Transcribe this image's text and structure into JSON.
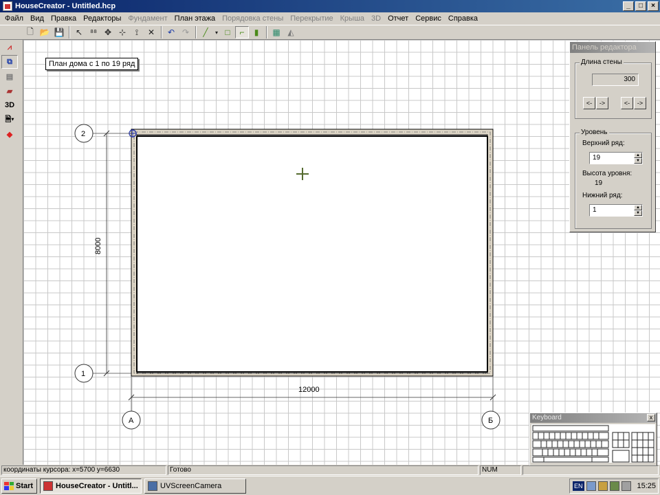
{
  "window": {
    "title": "HouseCreator - Untitled.hcp"
  },
  "menu": [
    "Файл",
    "Вид",
    "Правка",
    "Редакторы",
    "Фундамент",
    "План этажа",
    "Порядовка стены",
    "Перекрытие",
    "Крыша",
    "3D",
    "Отчет",
    "Сервис",
    "Справка"
  ],
  "menu_disabled": [
    false,
    false,
    false,
    false,
    true,
    false,
    true,
    true,
    true,
    true,
    false,
    false,
    false
  ],
  "left_toolbar": {
    "view3d_label": "3D"
  },
  "plan_label": "План дома с 1 по 19 ряд",
  "drawing": {
    "axis_rows": [
      "2",
      "1"
    ],
    "axis_cols": [
      "А",
      "Б"
    ],
    "dim_width": "12000",
    "dim_height": "8000"
  },
  "editor_panel": {
    "title": "Панель редактора",
    "wall_length_label": "Длина стены",
    "wall_length_value": "300",
    "btn_left": "<-",
    "btn_right": "->",
    "level_label": "Уровень",
    "top_row_label": "Верхний ряд:",
    "top_row_value": "19",
    "level_height_label": "Высота уровня:",
    "level_height_value": "19",
    "bottom_row_label": "Нижний ряд:",
    "bottom_row_value": "1"
  },
  "keyboard_window": {
    "title": "Keyboard",
    "close": "x"
  },
  "status": {
    "coords": "координаты курсора: x=5700 y=6630",
    "state": "Готово",
    "num": "NUM"
  },
  "taskbar": {
    "start": "Start",
    "tasks": [
      "HouseCreator - Untitl...",
      "UVScreenCamera"
    ],
    "lang": "EN",
    "clock": "15:25"
  }
}
